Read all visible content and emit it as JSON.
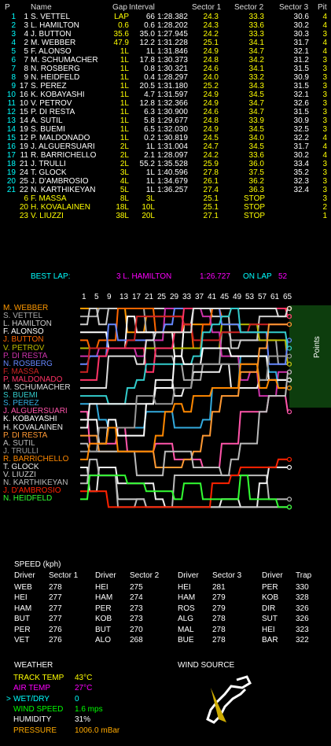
{
  "timing": {
    "headers": {
      "p": "P",
      "name": "Name",
      "gap": "Gap",
      "interval": "Interval",
      "s1": "Sector 1",
      "s2": "Sector 2",
      "s3": "Sector 3",
      "pit": "Pit"
    },
    "rows": [
      {
        "p": "1",
        "num": "1",
        "name": "S. VETTEL",
        "gap": "LAP",
        "int": "66",
        "lap": "1:28.382",
        "s1": "24.3",
        "s2": "33.3",
        "s3": "30.6",
        "pit": "4"
      },
      {
        "p": "2",
        "num": "3",
        "name": "L. HAMILTON",
        "gap": "0.6",
        "int": "0.6",
        "lap": "1:28.202",
        "s1": "24.3",
        "s2": "33.6",
        "s3": "30.2",
        "pit": "4"
      },
      {
        "p": "3",
        "num": "4",
        "name": "J. BUTTON",
        "gap": "35.6",
        "int": "35.0",
        "lap": "1:27.945",
        "s1": "24.2",
        "s2": "33.3",
        "s3": "30.3",
        "pit": "3"
      },
      {
        "p": "4",
        "num": "2",
        "name": "M. WEBBER",
        "gap": "47.9",
        "int": "12.2",
        "lap": "1:31.228",
        "s1": "25.1",
        "s2": "34.1",
        "s3": "31.7",
        "pit": "4"
      },
      {
        "p": "5",
        "num": "5",
        "name": "F. ALONSO",
        "gap": "1L",
        "int": "1L",
        "lap": "1:31.846",
        "s1": "24.9",
        "s2": "34.7",
        "s3": "32.1",
        "pit": "4"
      },
      {
        "p": "6",
        "num": "7",
        "name": "M. SCHUMACHER",
        "gap": "1L",
        "int": "17.8",
        "lap": "1:30.373",
        "s1": "24.8",
        "s2": "34.2",
        "s3": "31.2",
        "pit": "3"
      },
      {
        "p": "7",
        "num": "8",
        "name": "N. ROSBERG",
        "gap": "1L",
        "int": "0.8",
        "lap": "1:30.321",
        "s1": "24.6",
        "s2": "34.1",
        "s3": "31.5",
        "pit": "3"
      },
      {
        "p": "8",
        "num": "9",
        "name": "N. HEIDFELD",
        "gap": "1L",
        "int": "0.4",
        "lap": "1:28.297",
        "s1": "24.0",
        "s2": "33.2",
        "s3": "30.9",
        "pit": "3"
      },
      {
        "p": "9",
        "num": "17",
        "name": "S. PEREZ",
        "gap": "1L",
        "int": "20.5",
        "lap": "1:31.180",
        "s1": "25.2",
        "s2": "34.3",
        "s3": "31.5",
        "pit": "3"
      },
      {
        "p": "10",
        "num": "16",
        "name": "K. KOBAYASHI",
        "gap": "1L",
        "int": "4.7",
        "lap": "1:31.597",
        "s1": "24.9",
        "s2": "34.5",
        "s3": "32.1",
        "pit": "3"
      },
      {
        "p": "11",
        "num": "10",
        "name": "V. PETROV",
        "gap": "1L",
        "int": "12.8",
        "lap": "1:32.366",
        "s1": "24.9",
        "s2": "34.7",
        "s3": "32.6",
        "pit": "3"
      },
      {
        "p": "12",
        "num": "15",
        "name": "P. DI RESTA",
        "gap": "1L",
        "int": "6.3",
        "lap": "1:30.900",
        "s1": "24.6",
        "s2": "34.7",
        "s3": "31.5",
        "pit": "3"
      },
      {
        "p": "13",
        "num": "14",
        "name": "A. SUTIL",
        "gap": "1L",
        "int": "5.8",
        "lap": "1:29.677",
        "s1": "24.8",
        "s2": "33.9",
        "s3": "30.9",
        "pit": "3"
      },
      {
        "p": "14",
        "num": "19",
        "name": "S. BUEMI",
        "gap": "1L",
        "int": "6.5",
        "lap": "1:32.030",
        "s1": "24.9",
        "s2": "34.5",
        "s3": "32.5",
        "pit": "3"
      },
      {
        "p": "15",
        "num": "12",
        "name": "P. MALDONADO",
        "gap": "1L",
        "int": "0.2",
        "lap": "1:30.819",
        "s1": "24.5",
        "s2": "34.0",
        "s3": "32.2",
        "pit": "4"
      },
      {
        "p": "16",
        "num": "19",
        "name": "J. ALGUERSUARI",
        "gap": "2L",
        "int": "1L",
        "lap": "1:31.004",
        "s1": "24.7",
        "s2": "34.5",
        "s3": "31.7",
        "pit": "4"
      },
      {
        "p": "17",
        "num": "11",
        "name": "R. BARRICHELLO",
        "gap": "2L",
        "int": "2.1",
        "lap": "1:28.097",
        "s1": "24.2",
        "s2": "33.6",
        "s3": "30.2",
        "pit": "4"
      },
      {
        "p": "18",
        "num": "21",
        "name": "J. TRULLI",
        "gap": "2L",
        "int": "55.2",
        "lap": "1:35.528",
        "s1": "25.9",
        "s2": "36.0",
        "s3": "33.4",
        "pit": "3"
      },
      {
        "p": "19",
        "num": "24",
        "name": "T. GLOCK",
        "gap": "3L",
        "int": "1L",
        "lap": "1:40.596",
        "s1": "27.8",
        "s2": "37.5",
        "s3": "35.2",
        "pit": "3"
      },
      {
        "p": "20",
        "num": "25",
        "name": "J. D'AMBROSIO",
        "gap": "4L",
        "int": "1L",
        "lap": "1:34.679",
        "s1": "26.1",
        "s2": "36.2",
        "s3": "32.3",
        "pit": "3"
      },
      {
        "p": "21",
        "num": "22",
        "name": "N. KARTHIKEYAN",
        "gap": "5L",
        "int": "1L",
        "lap": "1:36.257",
        "s1": "27.4",
        "s2": "36.3",
        "s3": "32.4",
        "pit": "3"
      },
      {
        "p": "",
        "num": "6",
        "name": "F. MASSA",
        "gap": "8L",
        "int": "3L",
        "lap": "",
        "s1": "25.1",
        "s2": "STOP",
        "s3": "",
        "pit": "3"
      },
      {
        "p": "",
        "num": "20",
        "name": "H. KOVALAINEN",
        "gap": "18L",
        "int": "10L",
        "lap": "",
        "s1": "25.1",
        "s2": "STOP",
        "s3": "",
        "pit": "2"
      },
      {
        "p": "",
        "num": "23",
        "name": "V. LIUZZI",
        "gap": "38L",
        "int": "20L",
        "lap": "",
        "s1": "27.1",
        "s2": "STOP",
        "s3": "",
        "pit": "1"
      }
    ]
  },
  "best_lap": {
    "label": "BEST LAP:",
    "driver": "3 L. HAMILTON",
    "time": "1:26.727",
    "on_lap_label": "ON LAP",
    "lap": "52"
  },
  "chart": {
    "lap_ticks": [
      "1",
      "5",
      "9",
      "13",
      "17",
      "21",
      "25",
      "29",
      "33",
      "37",
      "41",
      "45",
      "49",
      "53",
      "57",
      "61",
      "65"
    ],
    "points_label": "Points",
    "drivers": [
      {
        "name": "M. WEBBER",
        "color": "#ff9900"
      },
      {
        "name": "S. VETTEL",
        "color": "#aaaaaa"
      },
      {
        "name": "L. HAMILTON",
        "color": "#cccccc"
      },
      {
        "name": "F. ALONSO",
        "color": "#ffffff"
      },
      {
        "name": "J. BUTTON",
        "color": "#ff6600"
      },
      {
        "name": "V. PETROV",
        "color": "#bbbb00"
      },
      {
        "name": "P. DI RESTA",
        "color": "#cc33aa"
      },
      {
        "name": "N. ROSBERG",
        "color": "#6688ff"
      },
      {
        "name": "F. MASSA",
        "color": "#cc2222"
      },
      {
        "name": "P. MALDONADO",
        "color": "#ff3366"
      },
      {
        "name": "M. SCHUMACHER",
        "color": "#dddddd"
      },
      {
        "name": "S. BUEMI",
        "color": "#33cccc"
      },
      {
        "name": "S. PEREZ",
        "color": "#33aadd"
      },
      {
        "name": "J. ALGUERSUARI",
        "color": "#ff55aa"
      },
      {
        "name": "K. KOBAYASHI",
        "color": "#ffffff"
      },
      {
        "name": "H. KOVALAINEN",
        "color": "#eeeeee"
      },
      {
        "name": "P. DI RESTA",
        "color": "#ff9933"
      },
      {
        "name": "A. SUTIL",
        "color": "#bbbbbb"
      },
      {
        "name": "J. TRULLI",
        "color": "#999999"
      },
      {
        "name": "R. BARRICHELLO",
        "color": "#ff8800"
      },
      {
        "name": "T. GLOCK",
        "color": "#eeeeee"
      },
      {
        "name": "V. LIUZZI",
        "color": "#cccccc"
      },
      {
        "name": "N. KARTHIKEYAN",
        "color": "#bbbbbb"
      },
      {
        "name": "J. D'AMBROSIO",
        "color": "#ff2200"
      },
      {
        "name": "N. HEIDFELD",
        "color": "#33ff33"
      }
    ]
  },
  "speed": {
    "title": "SPEED (kph)",
    "headers": [
      "Driver",
      "Sector 1",
      "Driver",
      "Sector 2",
      "Driver",
      "Sector 3",
      "Driver",
      "Trap"
    ],
    "rows": [
      [
        "WEB",
        "278",
        "HEI",
        "275",
        "HEI",
        "281",
        "PER",
        "330"
      ],
      [
        "HEI",
        "277",
        "HAM",
        "274",
        "HAM",
        "279",
        "KOB",
        "328"
      ],
      [
        "HAM",
        "277",
        "PER",
        "273",
        "ROS",
        "279",
        "DIR",
        "326"
      ],
      [
        "BUT",
        "277",
        "KOB",
        "273",
        "ALG",
        "278",
        "SUT",
        "326"
      ],
      [
        "PER",
        "276",
        "BUT",
        "270",
        "MAL",
        "278",
        "HEI",
        "323"
      ],
      [
        "VET",
        "276",
        "ALO",
        "268",
        "BUE",
        "278",
        "BAR",
        "322"
      ]
    ]
  },
  "weather": {
    "title": "WEATHER",
    "wind_source": "WIND SOURCE",
    "items": [
      {
        "label": "TRACK TEMP",
        "value": "43°C",
        "color": "#ffff00"
      },
      {
        "label": "AIR TEMP",
        "value": "27°C",
        "color": "#ff00ff"
      },
      {
        "label": "WET/DRY",
        "value": "0",
        "color": "#00ffff"
      },
      {
        "label": "WIND SPEED",
        "value": "1.6 mps",
        "color": "#00ff00"
      },
      {
        "label": "HUMIDITY",
        "value": "31%",
        "color": "#ffffff"
      },
      {
        "label": "PRESSURE",
        "value": "1006.0 mBar",
        "color": "#ffaa00"
      }
    ],
    "selected_marker": ">"
  }
}
